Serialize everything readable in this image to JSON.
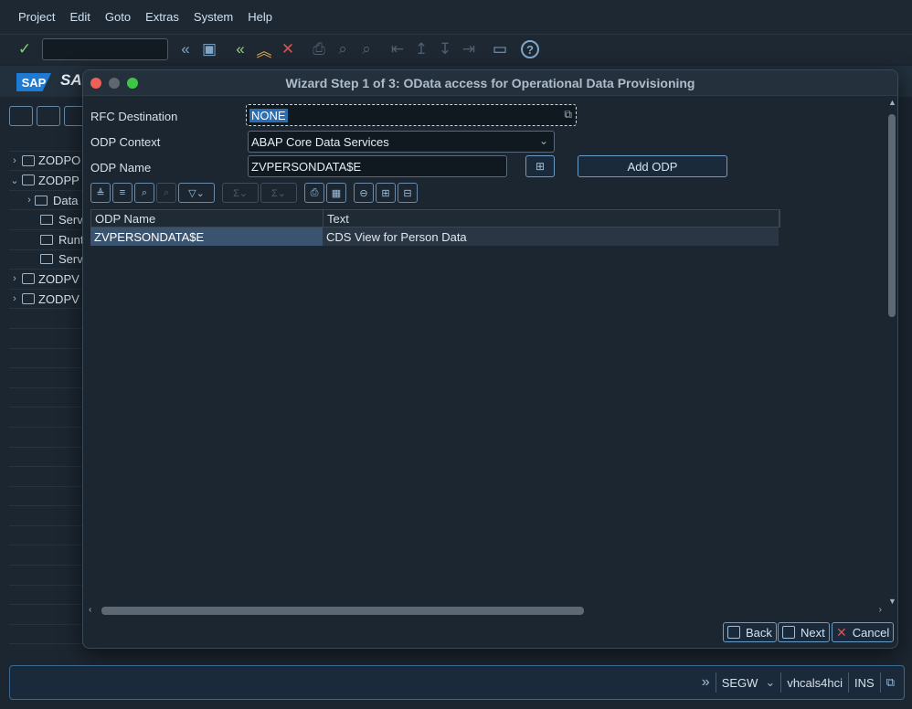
{
  "menu": [
    "Project",
    "Edit",
    "Goto",
    "Extras",
    "System",
    "Help"
  ],
  "toolbar_icons": [
    "check-icon",
    "back-double-icon",
    "save-icon",
    "back-icon",
    "up-icon",
    "cancel-icon",
    "print-icon",
    "find-icon",
    "find-next-icon",
    "first-page-icon",
    "prev-page-icon",
    "next-page-icon",
    "last-page-icon",
    "layout-icon",
    "help-icon"
  ],
  "app": {
    "title": "SA"
  },
  "tree": {
    "items": [
      {
        "label": "ZODPO",
        "kind": "project",
        "expanded": false
      },
      {
        "label": "ZODPP",
        "kind": "project",
        "expanded": true
      },
      {
        "label": "Data",
        "kind": "folder",
        "expanded": false
      },
      {
        "label": "Serv",
        "kind": "folder"
      },
      {
        "label": "Runt",
        "kind": "folder"
      },
      {
        "label": "Serv",
        "kind": "folder"
      },
      {
        "label": "ZODPV",
        "kind": "project",
        "expanded": false
      },
      {
        "label": "ZODPV",
        "kind": "project",
        "expanded": false
      }
    ]
  },
  "dialog": {
    "title": "Wizard Step 1 of 3: OData access for Operational Data Provisioning",
    "rfc_label": "RFC Destination",
    "rfc_value": "NONE",
    "context_label": "ODP Context",
    "context_value": "ABAP Core Data Services",
    "name_label": "ODP Name",
    "name_value": "ZVPERSONDATA$E",
    "add_button": "Add ODP",
    "table": {
      "headers": [
        "ODP Name",
        "Text"
      ],
      "rows": [
        [
          "ZVPERSONDATA$E",
          "CDS View for Person Data"
        ]
      ]
    },
    "back": "Back",
    "next": "Next",
    "cancel": "Cancel"
  },
  "status": {
    "transaction": "SEGW",
    "system": "vhcals4hci",
    "mode": "INS"
  }
}
